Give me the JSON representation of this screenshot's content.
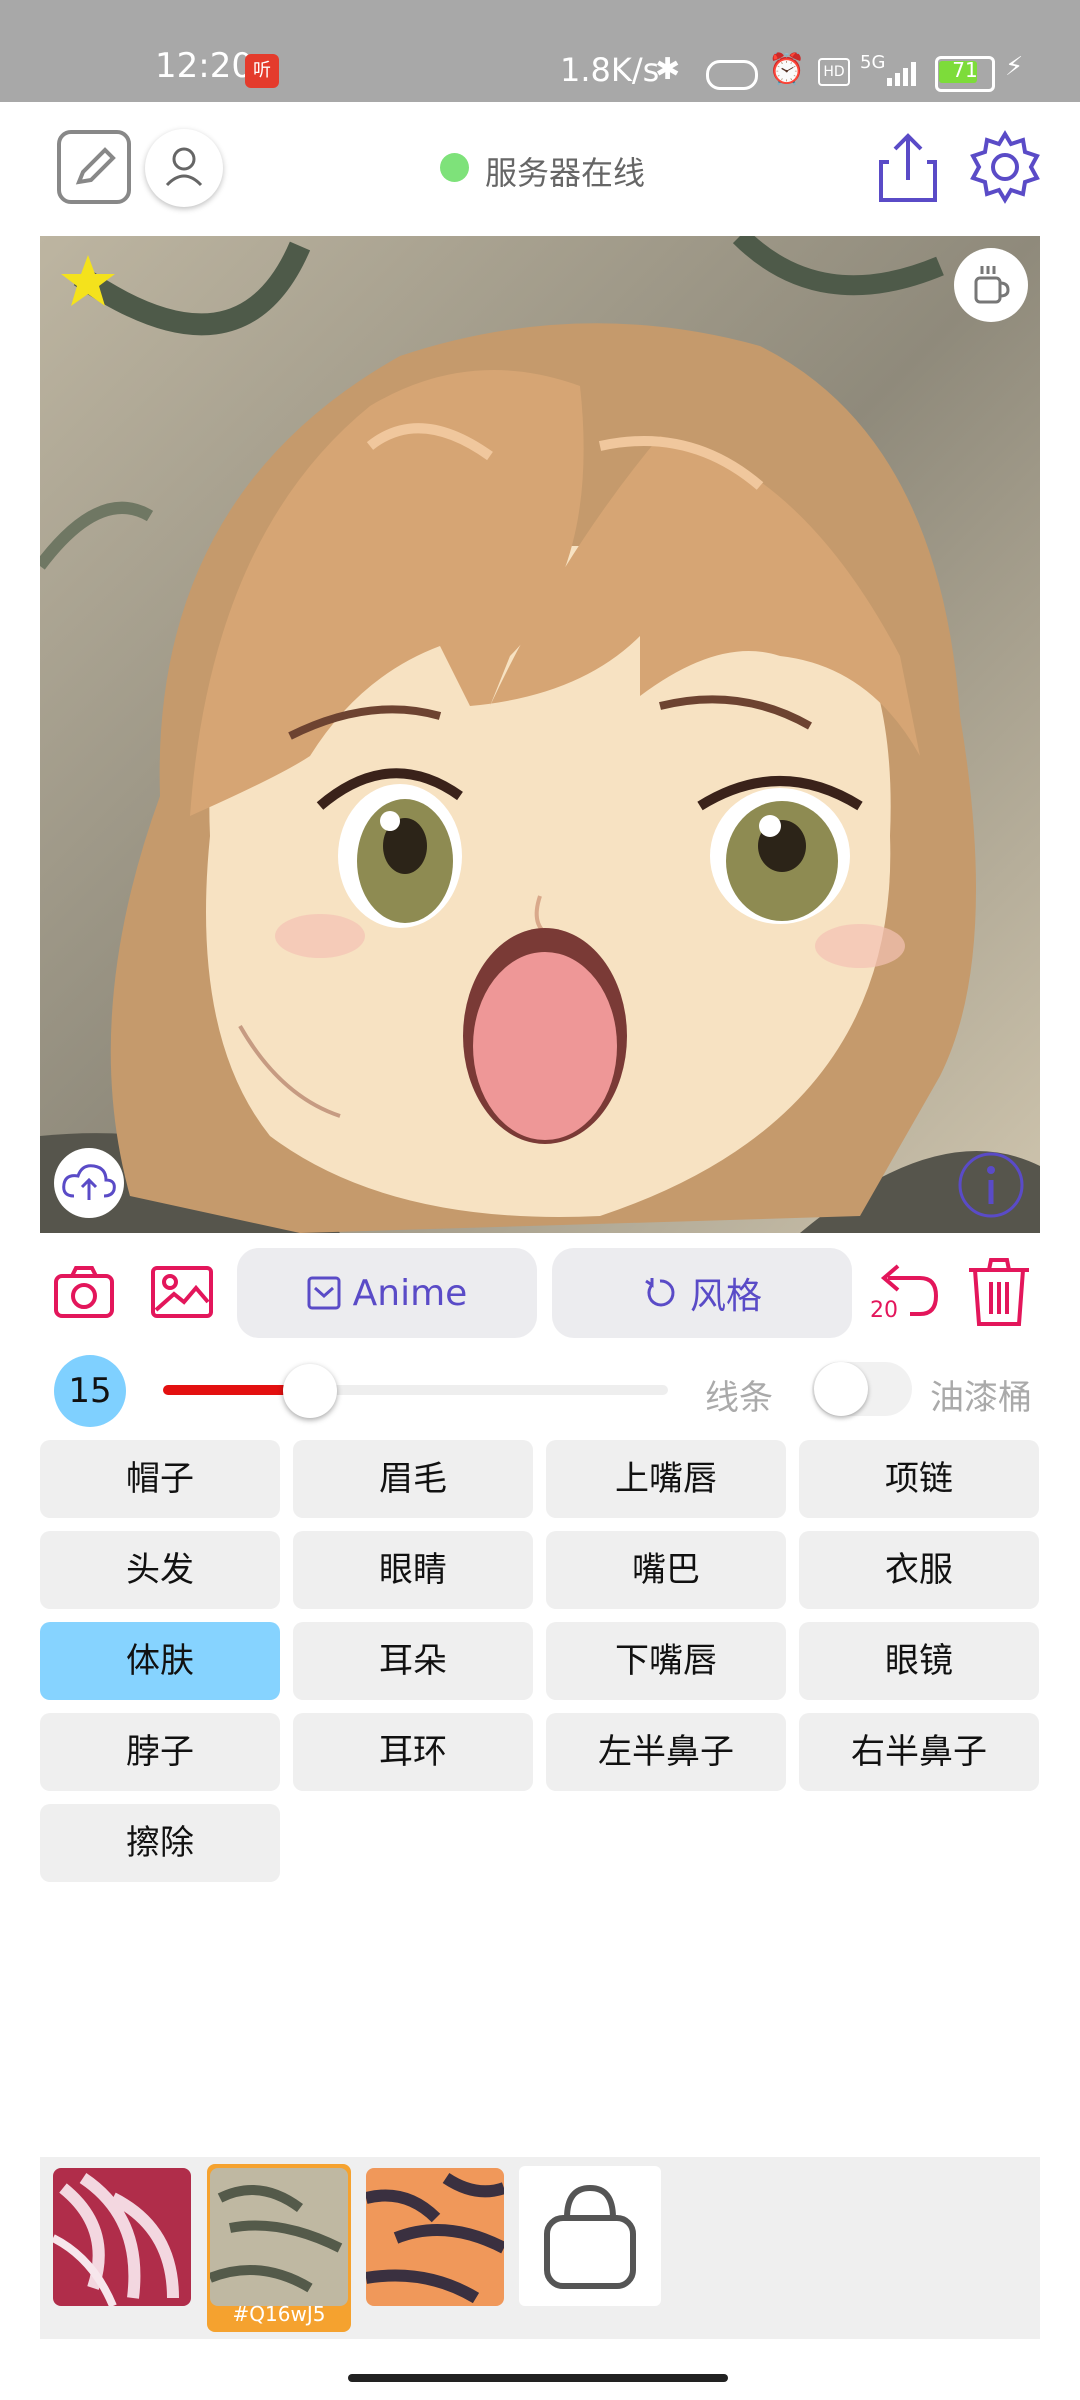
{
  "status_bar": {
    "time": "12:20",
    "app_badge": "听",
    "net_speed": "1.8K/s",
    "network": "5G",
    "battery_level": "71"
  },
  "top_bar": {
    "server_status": "服务器在线",
    "server_status_color": "#7ee27a"
  },
  "canvas": {
    "icons": [
      "star-icon",
      "coffee-cup-icon",
      "cloud-upload-icon",
      "info-icon"
    ]
  },
  "actions": {
    "anime_label": "Anime",
    "style_label": "风格",
    "undo_count": "20",
    "accent_color": "#e3165b",
    "primary_color": "#5a4bc7"
  },
  "brush": {
    "size": "15",
    "size_fraction": 0.27,
    "lines_label": "线条",
    "bucket_label": "油漆桶",
    "bucket_enabled": false
  },
  "parts": {
    "items": [
      "帽子",
      "眉毛",
      "上嘴唇",
      "项链",
      "头发",
      "眼睛",
      "嘴巴",
      "衣服",
      "体肤",
      "耳朵",
      "下嘴唇",
      "眼镜",
      "脖子",
      "耳环",
      "左半鼻子",
      "右半鼻子",
      "擦除"
    ],
    "active": "体肤"
  },
  "tray": {
    "selected_tag": "#Q16wJ5"
  }
}
